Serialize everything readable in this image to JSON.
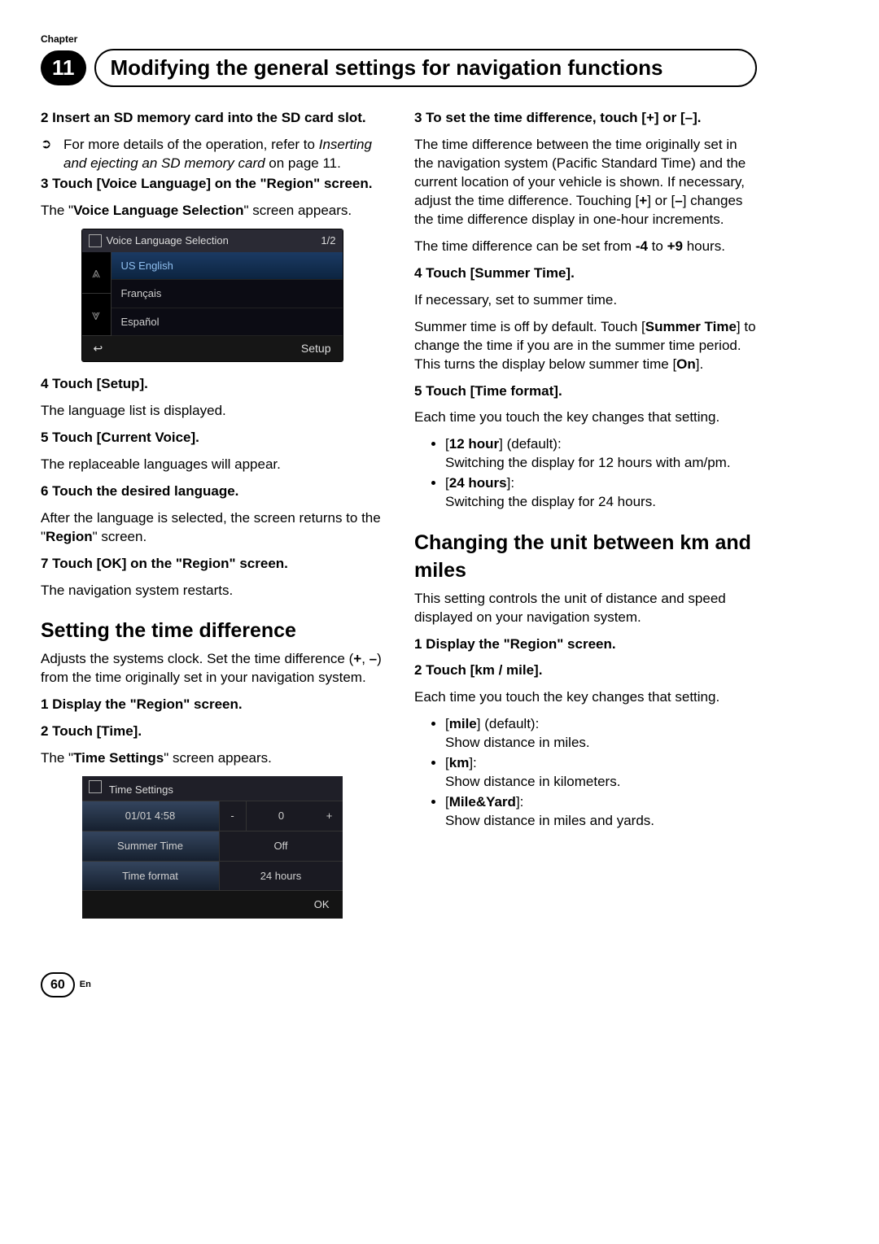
{
  "chapter": {
    "label": "Chapter",
    "num": "11",
    "title": "Modifying the general settings for navigation functions"
  },
  "left": {
    "s2_head": "2 Insert an SD memory card into the SD card slot.",
    "s2_ptr_a": "For more details of the operation, refer to ",
    "s2_ptr_i": "Inserting and ejecting an SD memory card",
    "s2_ptr_b": " on page 11.",
    "s3_head": "3 Touch [Voice Language] on the \"Region\" screen.",
    "s3_body_a": "The \"",
    "s3_body_b": "Voice Language Selection",
    "s3_body_c": "\" screen appears.",
    "vls": {
      "title": "Voice Language Selection",
      "page": "1/2",
      "item1": "US English",
      "item2": "Français",
      "item3": "Español",
      "setup": "Setup",
      "back": "↩",
      "up": "⩓",
      "down": "⩔"
    },
    "s4_head": "4 Touch [Setup].",
    "s4_body": "The language list is displayed.",
    "s5_head": "5 Touch [Current Voice].",
    "s5_body": "The replaceable languages will appear.",
    "s6_head": "6 Touch the desired language.",
    "s6_body_a": "After the language is selected, the screen returns to the \"",
    "s6_body_b": "Region",
    "s6_body_c": "\" screen.",
    "s7_head": "7 Touch [OK] on the \"Region\" screen.",
    "s7_body": "The navigation system restarts.",
    "h2_time": "Setting the time difference",
    "time_intro_a": "Adjusts the systems clock. Set the time difference (",
    "time_intro_b": "+",
    "time_intro_c": ", ",
    "time_intro_d": "–",
    "time_intro_e": ") from the time originally set in your navigation system.",
    "t1_head": "1 Display the \"Region\" screen.",
    "t2_head": "2 Touch [Time].",
    "t2_body_a": "The \"",
    "t2_body_b": "Time Settings",
    "t2_body_c": "\" screen appears.",
    "ts": {
      "title": "Time Settings",
      "row1l": "01/01 4:58",
      "row1minus": "-",
      "row1mid": "0",
      "row1plus": "+",
      "row2l": "Summer Time",
      "row2r": "Off",
      "row3l": "Time format",
      "row3r": "24 hours",
      "ok": "OK"
    }
  },
  "right": {
    "s3_head": "3 To set the time difference, touch [+] or [–].",
    "s3_b1_a": "The time difference between the time originally set in the navigation system (Pacific Standard Time) and the current location of your vehicle is shown. If necessary, adjust the time difference. Touching [",
    "s3_b1_b": "+",
    "s3_b1_c": "] or [",
    "s3_b1_d": "–",
    "s3_b1_e": "] changes the time difference display in one-hour increments.",
    "s3_b2_a": "The time difference can be set from ",
    "s3_b2_b": "-4",
    "s3_b2_c": " to ",
    "s3_b2_d": "+9",
    "s3_b2_e": " hours.",
    "s4_head": "4 Touch [Summer Time].",
    "s4_b1": "If necessary, set to summer time.",
    "s4_b2_a": "Summer time is off by default. Touch [",
    "s4_b2_b": "Summer Time",
    "s4_b2_c": "] to change the time if you are in the summer time period. This turns the display below summer time [",
    "s4_b2_d": "On",
    "s4_b2_e": "].",
    "s5_head": "5 Touch [Time format].",
    "s5_b1": "Each time you touch the key changes that setting.",
    "s5_li1_a": "[",
    "s5_li1_b": "12 hour",
    "s5_li1_c": "] (default):",
    "s5_li1_d": "Switching the display for 12 hours with am/pm.",
    "s5_li2_a": "[",
    "s5_li2_b": "24 hours",
    "s5_li2_c": "]:",
    "s5_li2_d": "Switching the display for 24 hours.",
    "h2_unit": "Changing the unit between km and miles",
    "unit_intro": "This setting controls the unit of distance and speed displayed on your navigation system.",
    "u1_head": "1 Display the \"Region\" screen.",
    "u2_head": "2 Touch [km / mile].",
    "u2_b1": "Each time you touch the key changes that setting.",
    "u_li1_a": "[",
    "u_li1_b": "mile",
    "u_li1_c": "] (default):",
    "u_li1_d": "Show distance in miles.",
    "u_li2_a": "[",
    "u_li2_b": "km",
    "u_li2_c": "]:",
    "u_li2_d": "Show distance in kilometers.",
    "u_li3_a": "[",
    "u_li3_b": "Mile&Yard",
    "u_li3_c": "]:",
    "u_li3_d": "Show distance in miles and yards."
  },
  "footer": {
    "page": "60",
    "lang": "En"
  }
}
